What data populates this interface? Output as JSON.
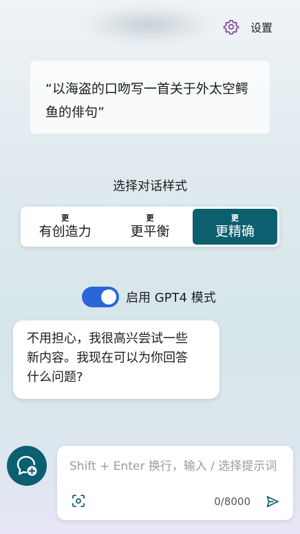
{
  "header": {
    "settings_label": "设置",
    "settings_icon": "gear-icon"
  },
  "prompt_card": {
    "line1": "“以海盗的口吻写一首关于外太空鳄",
    "line2": "鱼的俳句”"
  },
  "style_selector": {
    "title": "选择对话样式",
    "options": [
      {
        "prefix": "更",
        "label": "有创造力",
        "selected": false
      },
      {
        "prefix": "更",
        "label": "更平衡",
        "selected": false
      },
      {
        "prefix": "更",
        "label": "更精确",
        "selected": true
      }
    ]
  },
  "gpt4_toggle": {
    "label": "启用 GPT4 模式",
    "enabled": true
  },
  "assistant_message": {
    "line1": "不用担心，我很高兴尝试一些",
    "line2": "新内容。我现在可以为你回答",
    "line3": "什么问题?"
  },
  "composer": {
    "new_chat_icon": "new-chat-icon",
    "placeholder": "Shift + Enter 换行，输入 / 选择提示词",
    "value": "",
    "counter": "0/8000",
    "scan_icon": "scan-icon",
    "send_icon": "send-icon"
  },
  "colors": {
    "accent": "#0b5f6f",
    "toggle": "#2a66d7",
    "settings_icon": "#7a3f8c"
  }
}
